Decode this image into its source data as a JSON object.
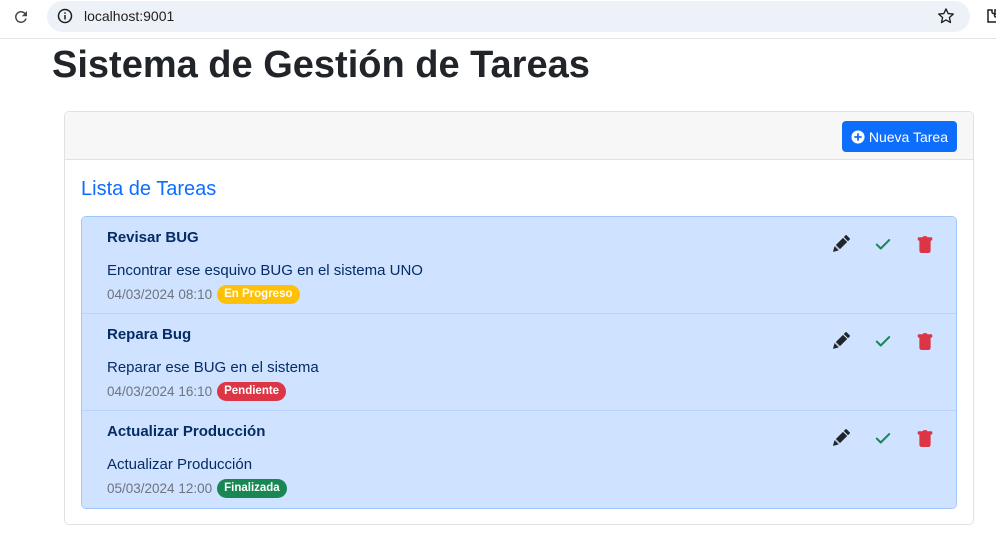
{
  "browser": {
    "url": "localhost:9001"
  },
  "page": {
    "title": "Sistema de Gestión de Tareas"
  },
  "toolbar": {
    "new_task_label": "Nueva Tarea"
  },
  "list": {
    "title": "Lista de Tareas",
    "tasks": [
      {
        "title": "Revisar BUG",
        "description": "Encontrar ese esquivo BUG en el sistema UNO",
        "datetime": "04/03/2024 08:10",
        "status": "En Progreso"
      },
      {
        "title": "Repara Bug",
        "description": "Reparar ese BUG en el sistema",
        "datetime": "04/03/2024 16:10",
        "status": "Pendiente"
      },
      {
        "title": "Actualizar Producción",
        "description": "Actualizar Producción",
        "datetime": "05/03/2024 12:00",
        "status": "Finalizada"
      }
    ]
  },
  "colors": {
    "primary": "#0d6efd",
    "in_progress": "#ffc107",
    "pending": "#dc3545",
    "done": "#198754",
    "list_bg": "#cfe2ff"
  },
  "icons": [
    "reload-icon",
    "info-icon",
    "star-icon",
    "extension-icon",
    "plus-circle-icon",
    "pencil-icon",
    "check-icon",
    "trash-icon"
  ]
}
